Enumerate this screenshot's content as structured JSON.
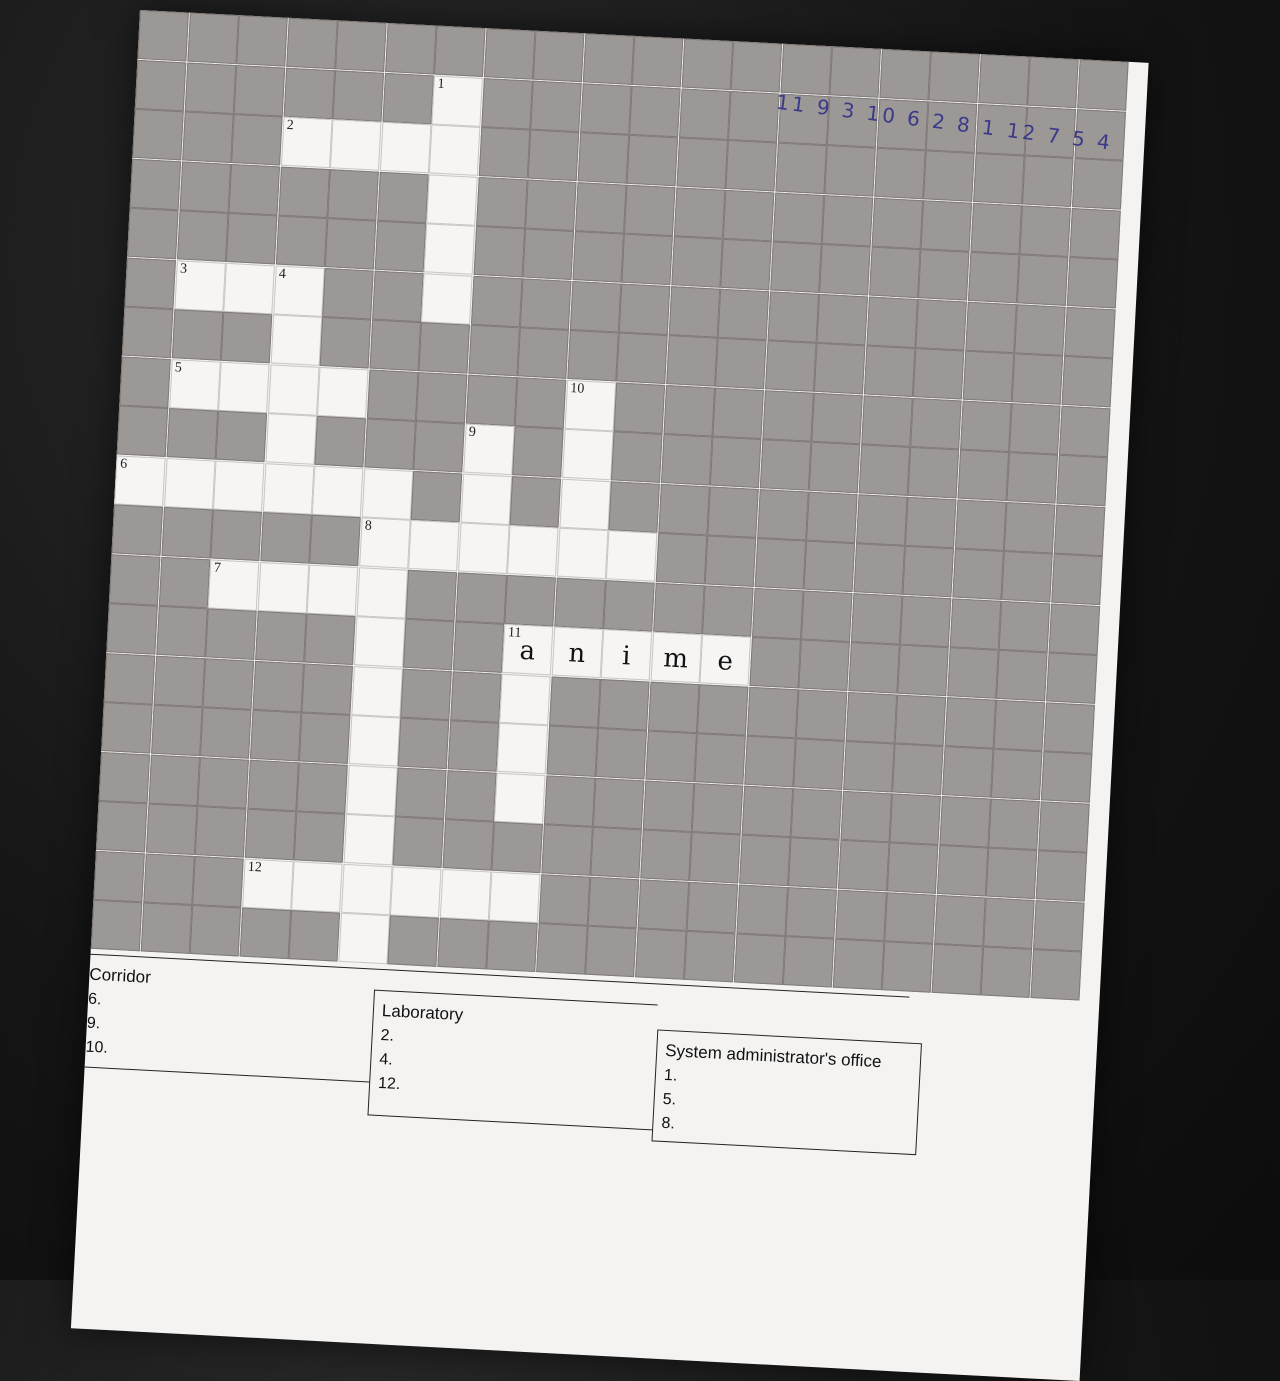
{
  "handwritten_sequence": "11 9 3 10 6 2 8 1 12 7 5 4",
  "clue_numbers": {
    "n1": "1",
    "n2": "2",
    "n3": "3",
    "n4": "4",
    "n5": "5",
    "n6": "6",
    "n7": "7",
    "n8": "8",
    "n9": "9",
    "n10": "10",
    "n11": "11",
    "n12": "12"
  },
  "filled_word": [
    "a",
    "n",
    "i",
    "m",
    "e"
  ],
  "sections": {
    "corridor": {
      "title": "Corridor",
      "items": [
        "6.",
        "9.",
        "10."
      ]
    },
    "laboratory": {
      "title": "Laboratory",
      "items": [
        "2.",
        "4.",
        "12."
      ]
    },
    "sysadmin": {
      "title": "System administrator's office",
      "items": [
        "1.",
        "5.",
        "8."
      ]
    }
  }
}
